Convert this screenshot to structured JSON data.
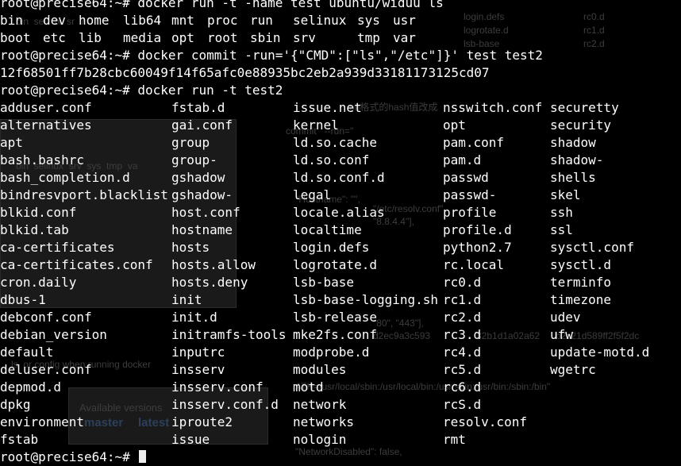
{
  "background_page": {
    "top_files": [
      "login.defs",
      "logrotate.d",
      "lsb-base"
    ],
    "top_rc": [
      "rc0.d",
      "rc1.d",
      "rc2.d"
    ],
    "ls_row": "bin  selinux  srv  sys  tmp  va",
    "left_fragment": "bin  sel  ux  sr  7",
    "config_note": "ls  or config when running docker",
    "versions_box": {
      "title": "Available versions",
      "tabs": [
        "master",
        "latest"
      ]
    },
    "json_fragments": [
      "commit   --run=\"",
      "on格式的hash值改成",
      "\"Hostname\": \"\",",
      "\"/etc/resolv.conf\"",
      "\"8.8.4.4\"],",
      "\"80\", \"443\"],",
      "d2ec9a3c593",
      "32b1d1a02a62",
      "b2c21d589ff2f5f2dc",
      "ATH=/usr/local/sbin:/usr/local/bin:/usr/sbin:/usr/bin:/sbin:/bin\"",
      "\"NetworkDisabled\": false,"
    ]
  },
  "terminal": {
    "prompt": "root@precise64:~# ",
    "lines": [
      {
        "type": "cmd",
        "text": "docker run -t -name test ubuntu/widuu ls"
      },
      {
        "type": "cols",
        "cells": [
          "bin",
          "dev",
          "home",
          "lib64",
          "mnt",
          "proc",
          "run",
          "selinux",
          "sys",
          "usr"
        ]
      },
      {
        "type": "cols",
        "cells": [
          "boot",
          "etc",
          "lib",
          "media",
          "opt",
          "root",
          "sbin",
          "srv",
          "tmp",
          "var"
        ]
      },
      {
        "type": "cmd",
        "text": "docker commit -run='{\"CMD\":[\"ls\",\"/etc\"]}' test test2"
      },
      {
        "type": "text",
        "text": "12f68501ff7b28cbc60049f14f65afc0e88935bc2eb2a939d33181173125cd07"
      },
      {
        "type": "cmd",
        "text": "docker run -t test2"
      },
      {
        "type": "cols5",
        "cells": [
          "adduser.conf",
          "fstab.d",
          "issue.net",
          "nsswitch.conf",
          "securetty"
        ]
      },
      {
        "type": "cols5",
        "cells": [
          "alternatives",
          "gai.conf",
          "kernel",
          "opt",
          "security"
        ]
      },
      {
        "type": "cols5",
        "cells": [
          "apt",
          "group",
          "ld.so.cache",
          "pam.conf",
          "shadow"
        ]
      },
      {
        "type": "cols5",
        "cells": [
          "bash.bashrc",
          "group-",
          "ld.so.conf",
          "pam.d",
          "shadow-"
        ]
      },
      {
        "type": "cols5",
        "cells": [
          "bash_completion.d",
          "gshadow",
          "ld.so.conf.d",
          "passwd",
          "shells"
        ]
      },
      {
        "type": "cols5",
        "cells": [
          "bindresvport.blacklist",
          "gshadow-",
          "legal",
          "passwd-",
          "skel"
        ]
      },
      {
        "type": "cols5",
        "cells": [
          "blkid.conf",
          "host.conf",
          "locale.alias",
          "profile",
          "ssh"
        ]
      },
      {
        "type": "cols5",
        "cells": [
          "blkid.tab",
          "hostname",
          "localtime",
          "profile.d",
          "ssl"
        ]
      },
      {
        "type": "cols5",
        "cells": [
          "ca-certificates",
          "hosts",
          "login.defs",
          "python2.7",
          "sysctl.conf"
        ]
      },
      {
        "type": "cols5",
        "cells": [
          "ca-certificates.conf",
          "hosts.allow",
          "logrotate.d",
          "rc.local",
          "sysctl.d"
        ]
      },
      {
        "type": "cols5",
        "cells": [
          "cron.daily",
          "hosts.deny",
          "lsb-base",
          "rc0.d",
          "terminfo"
        ]
      },
      {
        "type": "cols5",
        "cells": [
          "dbus-1",
          "init",
          "lsb-base-logging.sh",
          "rc1.d",
          "timezone"
        ]
      },
      {
        "type": "cols5",
        "cells": [
          "debconf.conf",
          "init.d",
          "lsb-release",
          "rc2.d",
          "udev"
        ]
      },
      {
        "type": "cols5",
        "cells": [
          "debian_version",
          "initramfs-tools",
          "mke2fs.conf",
          "rc3.d",
          "ufw"
        ]
      },
      {
        "type": "cols5",
        "cells": [
          "default",
          "inputrc",
          "modprobe.d",
          "rc4.d",
          "update-motd.d"
        ]
      },
      {
        "type": "cols5",
        "cells": [
          "deluser.conf",
          "insserv",
          "modules",
          "rc5.d",
          "wgetrc"
        ]
      },
      {
        "type": "cols5",
        "cells": [
          "depmod.d",
          "insserv.conf",
          "motd",
          "rc6.d",
          ""
        ]
      },
      {
        "type": "cols5",
        "cells": [
          "dpkg",
          "insserv.conf.d",
          "network",
          "rcS.d",
          ""
        ]
      },
      {
        "type": "cols5",
        "cells": [
          "environment",
          "iproute2",
          "networks",
          "resolv.conf",
          ""
        ]
      },
      {
        "type": "cols5",
        "cells": [
          "fstab",
          "issue",
          "nologin",
          "rmt",
          ""
        ]
      },
      {
        "type": "prompt_only",
        "text": ""
      }
    ]
  }
}
